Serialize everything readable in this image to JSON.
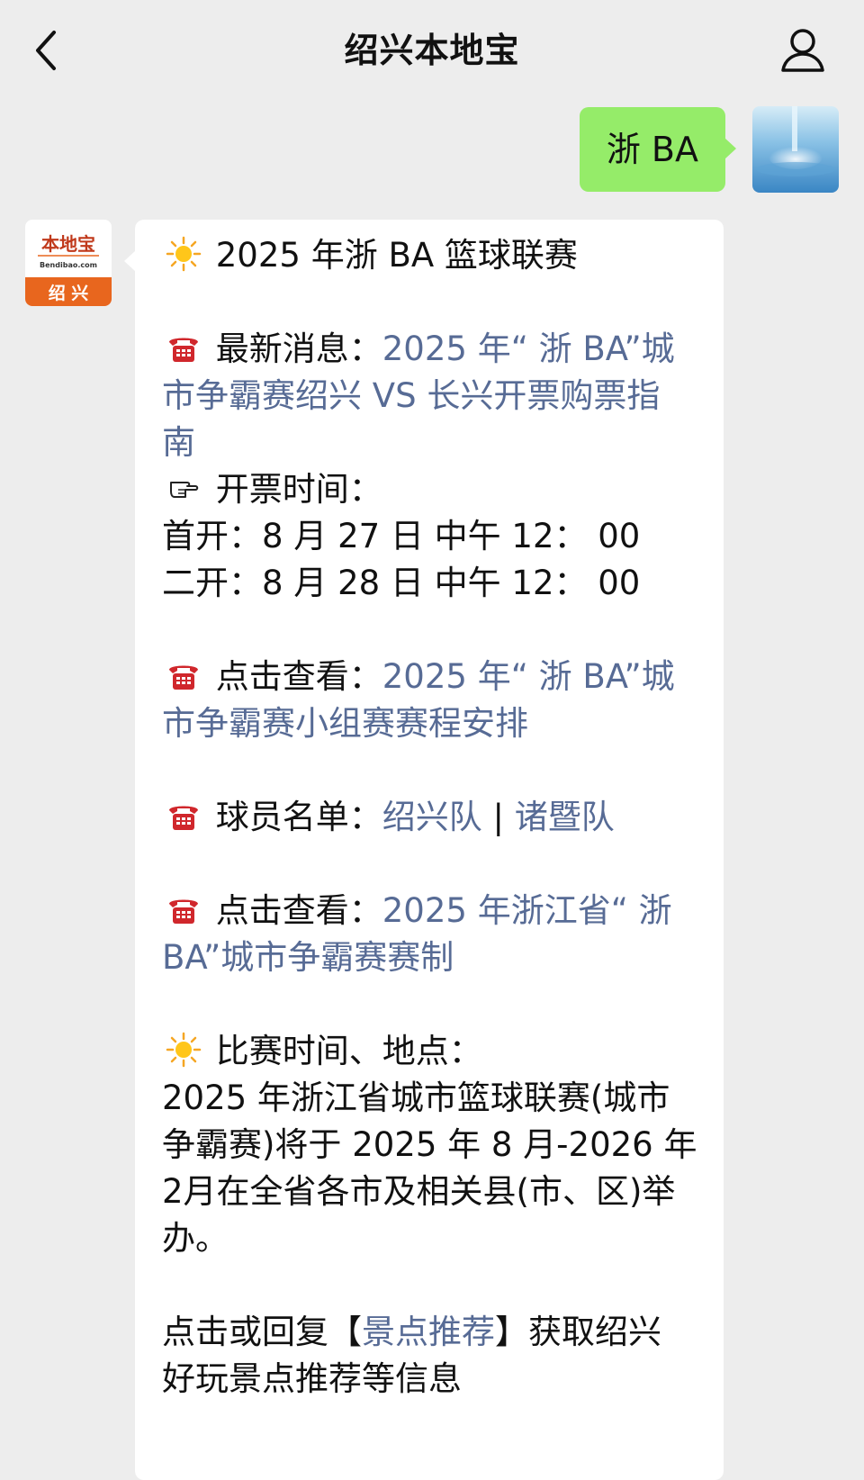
{
  "header": {
    "title": "绍兴本地宝",
    "back_icon": "chevron-left-icon",
    "profile_icon": "person-icon"
  },
  "colors": {
    "background": "#ededed",
    "sent_bubble": "#95ec69",
    "received_bubble": "#ffffff",
    "link": "#576b95",
    "brand_orange": "#e8661e"
  },
  "sent_message": {
    "text": "浙 BA"
  },
  "bot": {
    "avatar_top": "本地宝",
    "avatar_mid": "Bendibao.com",
    "avatar_bottom": "绍 兴"
  },
  "reply": {
    "title": "2025 年浙 BA 篮球联赛",
    "s1": {
      "label": "最新消息：",
      "link_l1": "2025 年“ 浙 BA”城",
      "link_l2": "市争霸赛绍兴 VS 长兴开票购票指",
      "link_l3": "南"
    },
    "ticket": {
      "heading": "开票时间：",
      "first": "首开：8 月 27 日 中午 12：  00",
      "second": "二开：8 月 28 日 中午 12：  00"
    },
    "s2": {
      "label": "点击查看：",
      "link_l1": "2025 年“ 浙 BA”城",
      "link_l2": "市争霸赛小组赛赛程安排"
    },
    "s3": {
      "label": "球员名单：",
      "link_a": "绍兴队",
      "sep": " | ",
      "link_b": "诸暨队"
    },
    "s4": {
      "label": "点击查看：",
      "link_l1": "2025 年浙江省“ 浙",
      "link_l2": "BA”城市争霸赛赛制"
    },
    "schedule": {
      "heading": "比赛时间、地点：",
      "l1": "2025 年浙江省城市篮球联赛(城市",
      "l2": "争霸赛)将于 2025 年 8 月-2026 年",
      "l3": "2月在全省各市及相关县(市、区)举",
      "l4": "办。"
    },
    "footer": {
      "pre": "点击或回复【",
      "link": "景点推荐",
      "post": "】获取绍兴",
      "l2": "好玩景点推荐等信息"
    },
    "icons": {
      "sun": "sun-icon",
      "phone": "telephone-icon",
      "pointing": "pointing-hand-icon"
    }
  }
}
